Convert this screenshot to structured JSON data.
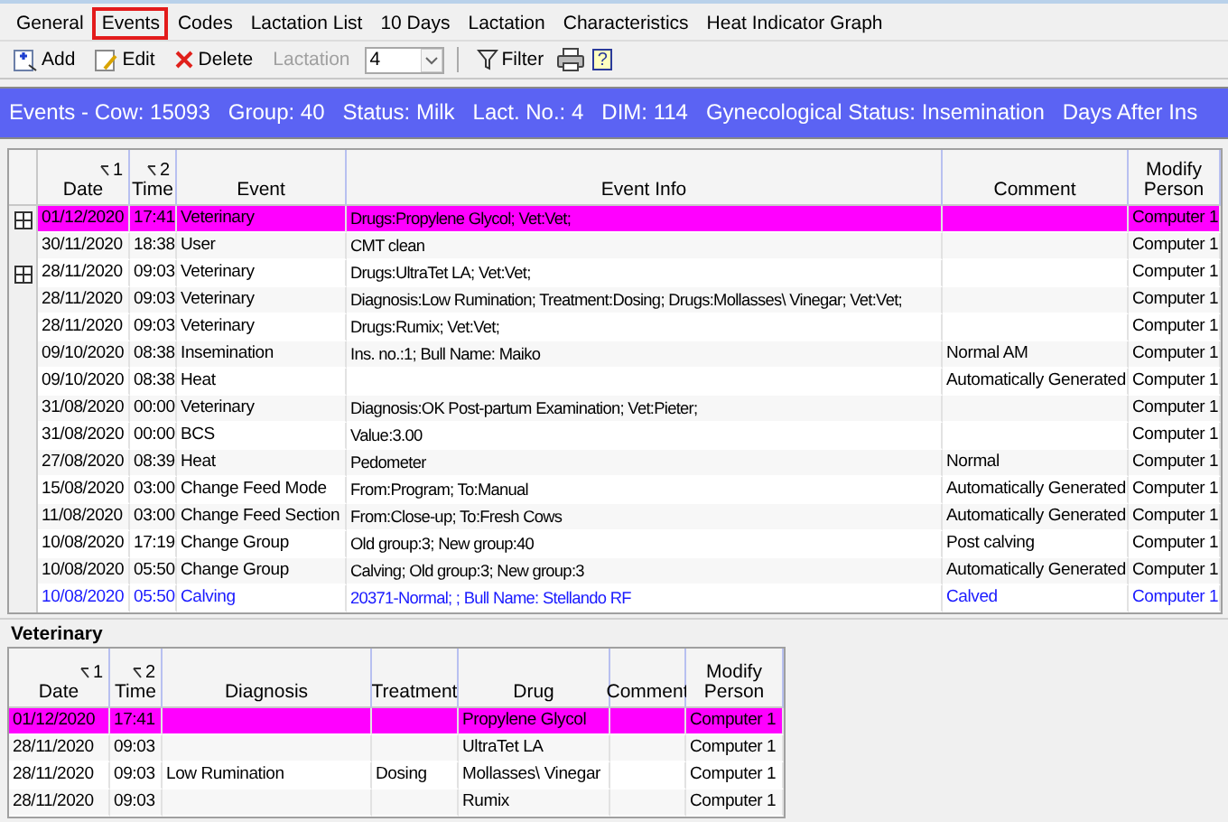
{
  "tabs": [
    {
      "label": "General",
      "selected": false
    },
    {
      "label": "Events",
      "selected": true
    },
    {
      "label": "Codes",
      "selected": false
    },
    {
      "label": "Lactation List",
      "selected": false
    },
    {
      "label": "10 Days",
      "selected": false
    },
    {
      "label": "Lactation",
      "selected": false
    },
    {
      "label": "Characteristics",
      "selected": false
    },
    {
      "label": "Heat Indicator Graph",
      "selected": false
    }
  ],
  "toolbar": {
    "add": "Add",
    "edit": "Edit",
    "delete": "Delete",
    "lactation": {
      "label": "Lactation",
      "disabled": true,
      "value": "4"
    },
    "filter": "Filter",
    "help": "?"
  },
  "header_band": "Events - Cow: 15093   Group: 40   Status: Milk   Lact. No.: 4   DIM: 114   Gynecological Status: Insemination   Days After Ins",
  "events_table": {
    "columns": [
      {
        "label": "Date",
        "sort": "1"
      },
      {
        "label": "Time",
        "sort": "2"
      },
      {
        "label": "Event"
      },
      {
        "label": "Event Info"
      },
      {
        "label": "Comment"
      },
      {
        "label": "Modify Person"
      }
    ],
    "rows": [
      {
        "selected": true,
        "expandable": true,
        "cells": [
          "01/12/2020",
          "17:41",
          "Veterinary",
          "Drugs:Propylene Glycol; Vet:Vet;",
          null,
          "Computer 1"
        ]
      },
      {
        "selected": false,
        "expandable": false,
        "cells": [
          "30/11/2020",
          "18:38",
          "User",
          "CMT clean",
          null,
          "Computer 1"
        ]
      },
      {
        "selected": false,
        "expandable": true,
        "cells": [
          "28/11/2020",
          "09:03",
          "Veterinary",
          "Drugs:UltraTet LA; Vet:Vet;",
          null,
          "Computer 1"
        ]
      },
      {
        "selected": false,
        "expandable": false,
        "cells": [
          "28/11/2020",
          "09:03",
          "Veterinary",
          "Diagnosis:Low Rumination; Treatment:Dosing; Drugs:Mollasses\\ Vinegar; Vet:Vet;",
          null,
          "Computer 1"
        ]
      },
      {
        "selected": false,
        "expandable": false,
        "cells": [
          "28/11/2020",
          "09:03",
          "Veterinary",
          "Drugs:Rumix; Vet:Vet;",
          null,
          "Computer 1"
        ]
      },
      {
        "selected": false,
        "expandable": false,
        "cells": [
          "09/10/2020",
          "08:38",
          "Insemination",
          "Ins. no.:1; Bull Name: Maiko",
          "Normal AM",
          "Computer 1"
        ]
      },
      {
        "selected": false,
        "expandable": false,
        "cells": [
          "09/10/2020",
          "08:38",
          "Heat",
          null,
          "Automatically Generated",
          "Computer 1"
        ]
      },
      {
        "selected": false,
        "expandable": false,
        "cells": [
          "31/08/2020",
          "00:00",
          "Veterinary",
          "Diagnosis:OK Post-partum Examination; Vet:Pieter;",
          null,
          "Computer 1"
        ]
      },
      {
        "selected": false,
        "expandable": false,
        "cells": [
          "31/08/2020",
          "00:00",
          "BCS",
          "Value:3.00",
          null,
          "Computer 1"
        ]
      },
      {
        "selected": false,
        "expandable": false,
        "cells": [
          "27/08/2020",
          "08:39",
          "Heat",
          "Pedometer",
          "Normal",
          "Computer 1"
        ]
      },
      {
        "selected": false,
        "expandable": false,
        "cells": [
          "15/08/2020",
          "03:00",
          "Change Feed Mode",
          "From:Program; To:Manual",
          "Automatically Generated",
          "Computer 1"
        ]
      },
      {
        "selected": false,
        "expandable": false,
        "cells": [
          "11/08/2020",
          "03:00",
          "Change Feed Section",
          "From:Close-up; To:Fresh Cows",
          "Automatically Generated",
          "Computer 1"
        ]
      },
      {
        "selected": false,
        "expandable": false,
        "cells": [
          "10/08/2020",
          "17:19",
          "Change Group",
          "Old group:3; New group:40",
          "Post calving",
          "Computer 1"
        ]
      },
      {
        "selected": false,
        "expandable": false,
        "cells": [
          "10/08/2020",
          "05:50",
          "Change Group",
          "Calving; Old group:3; New group:3",
          "Automatically Generated",
          "Computer 1"
        ]
      },
      {
        "selected": false,
        "expandable": false,
        "color": "#1a1aff",
        "cells": [
          "10/08/2020",
          "05:50",
          "Calving",
          "20371-Normal; ; Bull Name: Stellando RF",
          "Calved",
          "Computer 1"
        ]
      }
    ]
  },
  "veterinary": {
    "title": "Veterinary",
    "columns": [
      {
        "label": "Date",
        "sort": "1"
      },
      {
        "label": "Time",
        "sort": "2"
      },
      {
        "label": "Diagnosis"
      },
      {
        "label": "Treatment"
      },
      {
        "label": "Drug"
      },
      {
        "label": "Comment"
      },
      {
        "label": "Modify Person"
      }
    ],
    "rows": [
      {
        "selected": true,
        "cells": [
          "01/12/2020",
          "17:41",
          null,
          null,
          "Propylene Glycol",
          null,
          "Computer 1"
        ]
      },
      {
        "selected": false,
        "cells": [
          "28/11/2020",
          "09:03",
          null,
          null,
          "UltraTet LA",
          null,
          "Computer 1"
        ]
      },
      {
        "selected": false,
        "cells": [
          "28/11/2020",
          "09:03",
          "Low Rumination",
          "Dosing",
          "Mollasses\\ Vinegar",
          null,
          "Computer 1"
        ]
      },
      {
        "selected": false,
        "cells": [
          "28/11/2020",
          "09:03",
          null,
          null,
          "Rumix",
          null,
          "Computer 1"
        ]
      }
    ]
  }
}
